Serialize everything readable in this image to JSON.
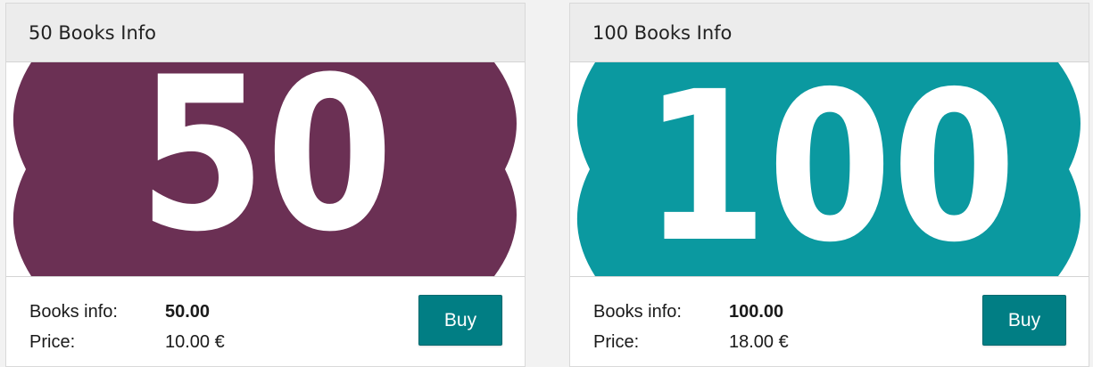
{
  "cards": [
    {
      "title": "50 Books Info",
      "badge_number": "50",
      "badge_color": "#6b3054",
      "books_info_label": "Books info:",
      "books_info_value": "50.00",
      "price_label": "Price:",
      "price_value": "10.00 €",
      "buy_label": "Buy"
    },
    {
      "title": "100 Books Info",
      "badge_number": "100",
      "badge_color": "#0b99a0",
      "books_info_label": "Books info:",
      "books_info_value": "100.00",
      "price_label": "Price:",
      "price_value": "18.00 €",
      "buy_label": "Buy"
    }
  ],
  "colors": {
    "button": "#017e84",
    "page_background": "#f2f2f2"
  }
}
